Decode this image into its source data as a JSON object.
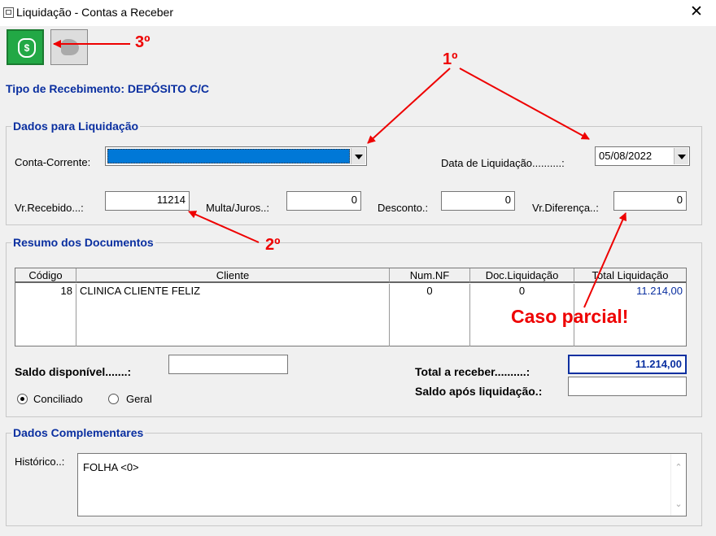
{
  "window": {
    "title": "Liquidação - Contas a Receber"
  },
  "recebimento": {
    "label": "Tipo de Recebimento: DEPÓSITO C/C"
  },
  "liquidacao": {
    "legend": "Dados para Liquidação",
    "conta_label": "Conta-Corrente:",
    "data_label": "Data de Liquidação..........:",
    "data_value": "05/08/2022",
    "vr_recebido_label": "Vr.Recebido...:",
    "vr_recebido_value": "11214",
    "multa_label": "Multa/Juros..:",
    "multa_value": "0",
    "desconto_label": "Desconto.:",
    "desconto_value": "0",
    "diferenca_label": "Vr.Diferença..:",
    "diferenca_value": "0"
  },
  "resumo": {
    "legend": "Resumo dos Documentos",
    "columns": [
      "Código",
      "Cliente",
      "Num.NF",
      "Doc.Liquidação",
      "Total Liquidação"
    ],
    "row": {
      "codigo": "18",
      "cliente": "CLINICA CLIENTE FELIZ",
      "num_nf": "0",
      "doc_liquidacao": "0",
      "total_liquidacao": "11.214,00"
    },
    "saldo_label": "Saldo disponível.......:",
    "total_label": "Total a receber..........:",
    "total_value": "11.214,00",
    "saldo_apos_label": "Saldo após liquidação.:",
    "radio_conciliado": "Conciliado",
    "radio_geral": "Geral"
  },
  "complementares": {
    "legend": "Dados Complementares",
    "historico_label": "Histórico..:",
    "historico_value": "FOLHA <0>"
  },
  "annotations": {
    "a1": "1º",
    "a2": "2º",
    "a3": "3º",
    "parcial": "Caso parcial!"
  },
  "colors": {
    "accent": "#0a2fa0",
    "annotation": "#e00000",
    "selection": "#0078d7",
    "money_button": "#22a845"
  },
  "icons": {
    "money": "money-bag-icon",
    "map": "map-icon"
  }
}
